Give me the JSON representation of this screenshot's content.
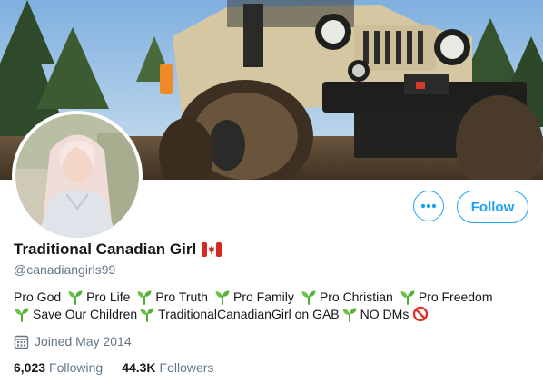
{
  "profile": {
    "display_name": "Traditional Canadian Girl",
    "flag_icon": "canada-flag-icon",
    "handle": "@canadiangirls99",
    "bio_line1": [
      "Pro God",
      "Pro Life",
      "Pro Truth",
      "Pro Family",
      "Pro Christian",
      "Pro Freedom"
    ],
    "bio_line2": [
      "Save Our Children",
      "TraditionalCanadianGirl on GAB",
      "NO DMs"
    ],
    "bio_icon": "seedling-icon",
    "end_icon": "prohibited-icon",
    "joined": "Joined May 2014",
    "following_count": "6,023",
    "following_label": "Following",
    "followers_count": "44.3K",
    "followers_label": "Followers"
  },
  "actions": {
    "more_icon": "more-dots-icon",
    "follow_label": "Follow"
  },
  "colors": {
    "accent": "#1da1f2",
    "secondary_text": "#657786",
    "primary_text": "#14171a"
  }
}
